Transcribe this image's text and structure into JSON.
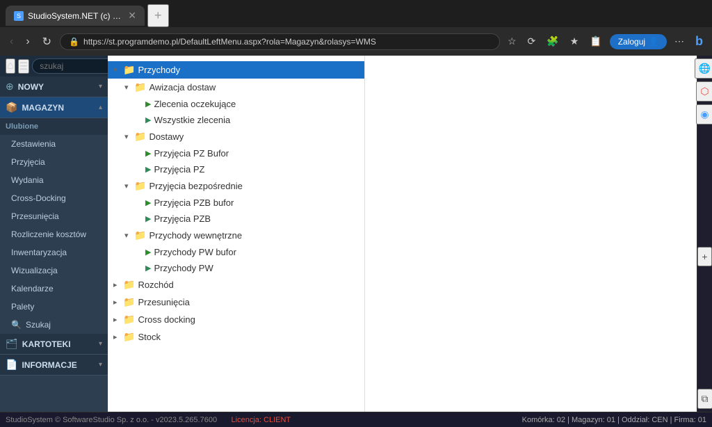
{
  "browser": {
    "tab_label": "StudioSystem.NET (c) SoftwareS...",
    "url": "https://st.programdemo.pl/DefaultLeftMenu.aspx?rola=Magazyn&rolasys=WMS",
    "login_btn": "Zaloguj"
  },
  "app_toolbar": {
    "search_placeholder": "szukaj"
  },
  "sidebar": {
    "nowy_label": "NOWY",
    "magazyn_label": "MAGAZYN",
    "ulubione_label": "Ulubione",
    "zestawienia_label": "Zestawienia",
    "przyjecia_label": "Przyjęcia",
    "wydania_label": "Wydania",
    "cross_docking_label": "Cross-Docking",
    "przesuniecia_label": "Przesunięcia",
    "rozliczenie_kosztow_label": "Rozliczenie kosztów",
    "inwentaryzacja_label": "Inwentaryzacja",
    "wizualizacja_label": "Wizualizacja",
    "kalendarze_label": "Kalendarze",
    "palety_label": "Palety",
    "szukaj_label": "Szukaj",
    "kartoteki_label": "KARTOTEKI",
    "informacje_label": "INFORMACJE"
  },
  "tree": {
    "items": [
      {
        "id": "przychody",
        "label": "Przychody",
        "level": 0,
        "type": "folder",
        "expanded": true,
        "selected": true,
        "toggle": "▾"
      },
      {
        "id": "awizacja",
        "label": "Awizacja dostaw",
        "level": 1,
        "type": "folder",
        "expanded": true,
        "toggle": "▾"
      },
      {
        "id": "zlecenia",
        "label": "Zlecenia oczekujące",
        "level": 2,
        "type": "play",
        "toggle": ""
      },
      {
        "id": "wszystkie",
        "label": "Wszystkie zlecenia",
        "level": 2,
        "type": "play2",
        "toggle": ""
      },
      {
        "id": "dostawy",
        "label": "Dostawy",
        "level": 1,
        "type": "folder",
        "expanded": true,
        "toggle": "▾"
      },
      {
        "id": "przyjecia_pz_bufor",
        "label": "Przyjęcia PZ Bufor",
        "level": 2,
        "type": "play",
        "toggle": ""
      },
      {
        "id": "przyjecia_pz",
        "label": "Przyjęcia PZ",
        "level": 2,
        "type": "play2",
        "toggle": ""
      },
      {
        "id": "przyjecia_bezposrednie",
        "label": "Przyjęcia bezpośrednie",
        "level": 1,
        "type": "folder",
        "expanded": true,
        "toggle": "▾"
      },
      {
        "id": "przyjecia_pzb_bufor",
        "label": "Przyjęcia PZB bufor",
        "level": 2,
        "type": "play",
        "toggle": ""
      },
      {
        "id": "przyjecia_pzb",
        "label": "Przyjęcia PZB",
        "level": 2,
        "type": "play2",
        "toggle": ""
      },
      {
        "id": "przychody_wewnetrzne",
        "label": "Przychody wewnętrzne",
        "level": 1,
        "type": "folder",
        "expanded": true,
        "toggle": "▾"
      },
      {
        "id": "przychody_pw_bufor",
        "label": "Przychody PW bufor",
        "level": 2,
        "type": "play",
        "toggle": ""
      },
      {
        "id": "przychody_pw",
        "label": "Przychody PW",
        "level": 2,
        "type": "play2",
        "toggle": ""
      },
      {
        "id": "rozchod",
        "label": "Rozchód",
        "level": 0,
        "type": "folder",
        "expanded": false,
        "toggle": "▸"
      },
      {
        "id": "przesuniecia",
        "label": "Przesunięcia",
        "level": 0,
        "type": "folder",
        "expanded": false,
        "toggle": "▸"
      },
      {
        "id": "cross_docking",
        "label": "Cross docking",
        "level": 0,
        "type": "folder",
        "expanded": false,
        "toggle": "▸"
      },
      {
        "id": "stock",
        "label": "Stock",
        "level": 0,
        "type": "folder2",
        "expanded": false,
        "toggle": "▸"
      }
    ]
  },
  "status_bar": {
    "left": "StudioSystem © SoftwareStudio Sp. z o.o. - v2023.5.265.7600",
    "link": "Licencja: CLIENT",
    "right": "Komórka: 02 | Magazyn: 01 | Oddział: CEN | Firma: 01"
  }
}
